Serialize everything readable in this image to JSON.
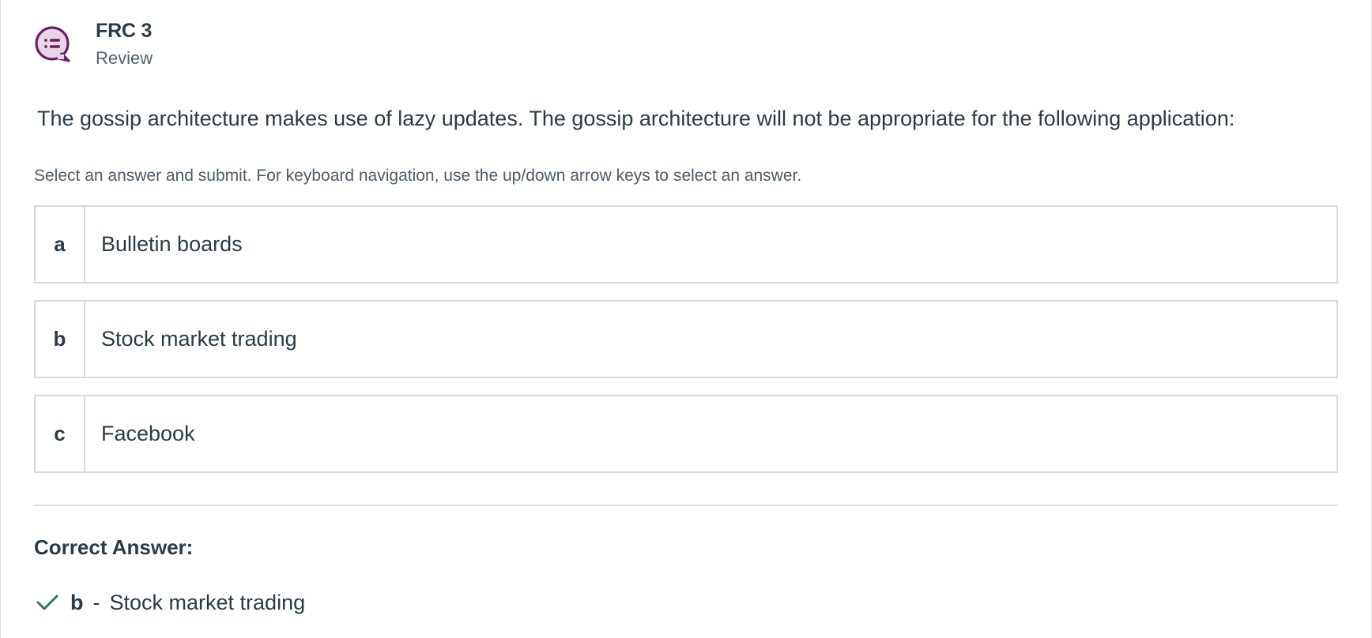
{
  "header": {
    "title": "FRC 3",
    "subtitle": "Review",
    "icon": "list-chat-bubble-icon",
    "icon_color": "#6b1f64"
  },
  "question": {
    "text": "The gossip architecture makes use of lazy updates. The gossip architecture will not be appropriate for the following application:",
    "instructions": "Select an answer and submit. For keyboard navigation, use the up/down arrow keys to select an answer."
  },
  "options": [
    {
      "letter": "a",
      "text": "Bulletin boards"
    },
    {
      "letter": "b",
      "text": "Stock market trading"
    },
    {
      "letter": "c",
      "text": "Facebook"
    }
  ],
  "correct_answer": {
    "label": "Correct Answer:",
    "letter": "b",
    "separator": "-",
    "text": "Stock market trading",
    "icon": "checkmark-icon",
    "icon_color": "#2f7a5a"
  }
}
